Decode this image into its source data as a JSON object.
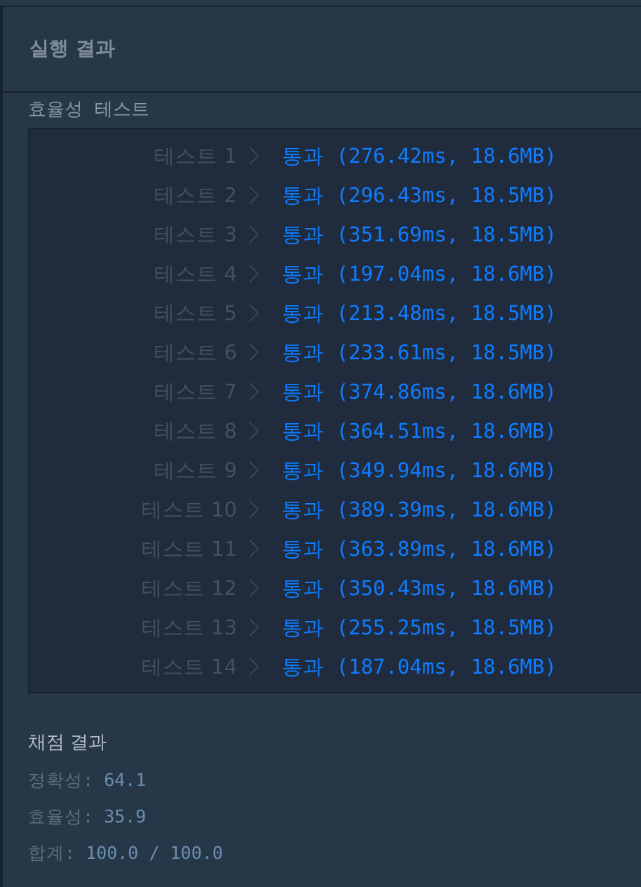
{
  "panel": {
    "title": "실행 결과"
  },
  "section_label": "효율성  테스트",
  "results": [
    {
      "label": "테스트 1",
      "kind": "pass",
      "status": "통과",
      "detail": "(276.42ms, 18.6MB)"
    },
    {
      "label": "테스트 2",
      "kind": "pass",
      "status": "통과",
      "detail": "(296.43ms, 18.5MB)"
    },
    {
      "label": "테스트 3",
      "kind": "pass",
      "status": "통과",
      "detail": "(351.69ms, 18.5MB)"
    },
    {
      "label": "테스트 4",
      "kind": "pass",
      "status": "통과",
      "detail": "(197.04ms, 18.6MB)"
    },
    {
      "label": "테스트 5",
      "kind": "pass",
      "status": "통과",
      "detail": "(213.48ms, 18.5MB)"
    },
    {
      "label": "테스트 6",
      "kind": "pass",
      "status": "통과",
      "detail": "(233.61ms, 18.5MB)"
    },
    {
      "label": "테스트 7",
      "kind": "pass",
      "status": "통과",
      "detail": "(374.86ms, 18.6MB)"
    },
    {
      "label": "테스트 8",
      "kind": "pass",
      "status": "통과",
      "detail": "(364.51ms, 18.6MB)"
    },
    {
      "label": "테스트 9",
      "kind": "pass",
      "status": "통과",
      "detail": "(349.94ms, 18.6MB)"
    },
    {
      "label": "테스트 10",
      "kind": "pass",
      "status": "통과",
      "detail": "(389.39ms, 18.6MB)"
    },
    {
      "label": "테스트 11",
      "kind": "pass",
      "status": "통과",
      "detail": "(363.89ms, 18.6MB)"
    },
    {
      "label": "테스트 12",
      "kind": "pass",
      "status": "통과",
      "detail": "(350.43ms, 18.6MB)"
    },
    {
      "label": "테스트 13",
      "kind": "pass",
      "status": "통과",
      "detail": "(255.25ms, 18.5MB)"
    },
    {
      "label": "테스트 14",
      "kind": "pass",
      "status": "통과",
      "detail": "(187.04ms, 18.6MB)"
    }
  ],
  "score": {
    "title": "채점 결과",
    "lines": [
      {
        "label": "정확성:",
        "value": "64.1"
      },
      {
        "label": "효율성:",
        "value": "35.9"
      },
      {
        "label": "합계:",
        "value": "100.0 / 100.0"
      }
    ]
  }
}
